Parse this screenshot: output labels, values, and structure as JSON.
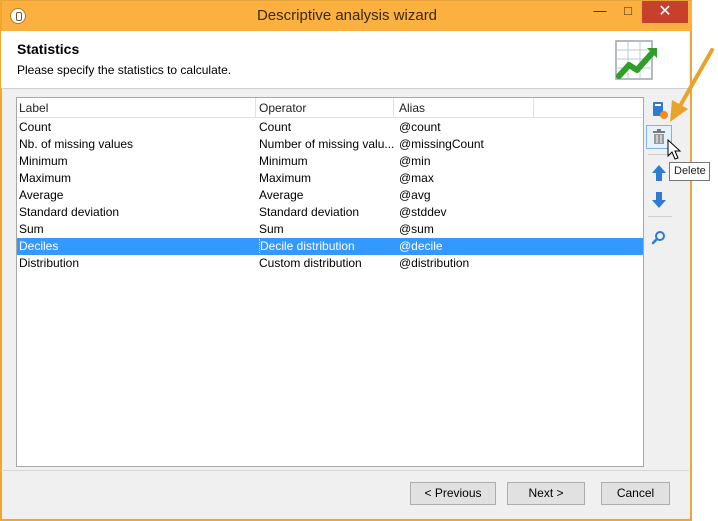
{
  "window": {
    "title": "Descriptive analysis wizard",
    "minimize": "—",
    "maximize": "□",
    "close": "✕"
  },
  "header": {
    "title": "Statistics",
    "subtitle": "Please specify the statistics to calculate."
  },
  "table": {
    "columns": [
      "Label",
      "Operator",
      "Alias"
    ],
    "rows": [
      {
        "label": "Count",
        "operator": "Count",
        "alias": "@count"
      },
      {
        "label": "Nb. of missing values",
        "operator": "Number of missing valu...",
        "alias": "@missingCount"
      },
      {
        "label": "Minimum",
        "operator": "Minimum",
        "alias": "@min"
      },
      {
        "label": "Maximum",
        "operator": "Maximum",
        "alias": "@max"
      },
      {
        "label": "Average",
        "operator": "Average",
        "alias": "@avg"
      },
      {
        "label": "Standard deviation",
        "operator": "Standard deviation",
        "alias": "@stddev"
      },
      {
        "label": "Sum",
        "operator": "Sum",
        "alias": "@sum"
      },
      {
        "label": "Deciles",
        "operator": "Decile distribution",
        "alias": "@decile"
      },
      {
        "label": "Distribution",
        "operator": "Custom distribution",
        "alias": "@distribution"
      }
    ],
    "selected_index": 7
  },
  "toolbar": {
    "icons": [
      "add-icon",
      "delete-icon",
      "move-up-icon",
      "move-down-icon",
      "search-icon"
    ]
  },
  "tooltip": {
    "text": "Delete"
  },
  "footer": {
    "previous_label": "< Previous",
    "next_label": "Next >",
    "cancel_label": "Cancel"
  },
  "colors": {
    "titlebar": "#fbb040",
    "selection": "#3399ff",
    "close": "#c7402c",
    "arrow_annotation": "#e8a32a"
  }
}
